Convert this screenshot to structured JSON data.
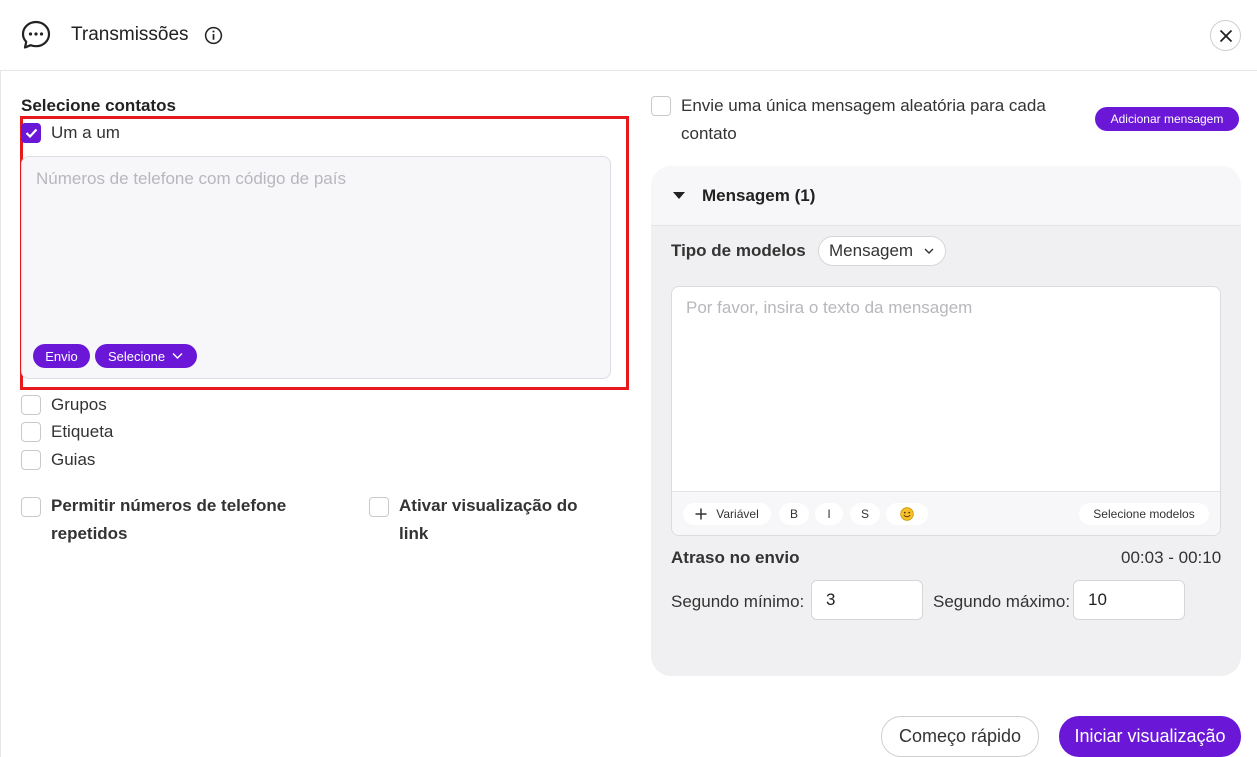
{
  "header": {
    "title": "Transmissões",
    "icons": {
      "app": "chat-dots-icon",
      "info": "info-icon",
      "close": "close-icon"
    }
  },
  "contacts": {
    "section_label": "Selecione contatos",
    "one_by_one": {
      "label": "Um a um",
      "checked": true
    },
    "phone_placeholder": "Números de telefone com código de país",
    "send_btn": "Envio",
    "select_btn": "Selecione",
    "groups": {
      "label": "Grupos",
      "checked": false
    },
    "tag": {
      "label": "Etiqueta",
      "checked": false
    },
    "guides": {
      "label": "Guias",
      "checked": false
    }
  },
  "options": {
    "allow_repeat": {
      "label": "Permitir números de telefone repetidos",
      "checked": false
    },
    "link_preview": {
      "label": "Ativar visualização do link",
      "checked": false
    }
  },
  "random_message": {
    "label": "Envie uma única mensagem aleatória para cada contato",
    "checked": false,
    "add_btn": "Adicionar mensagem"
  },
  "message_panel": {
    "title": "Mensagem (1)",
    "template_type_label": "Tipo de modelos",
    "template_type_value": "Mensagem",
    "message_placeholder": "Por favor, insira o texto da mensagem",
    "toolbar": {
      "variable": "Variável",
      "bold": "B",
      "italic": "I",
      "strike": "S",
      "emoji_icon": "emoji-icon",
      "select_templates": "Selecione modelos"
    },
    "delay": {
      "label": "Atraso no envio",
      "range": "00:03 - 00:10",
      "min_label": "Segundo mínimo",
      "min_value": "3",
      "max_label": "Segundo máximo",
      "max_value": "10"
    }
  },
  "footer": {
    "quick_start": "Começo rápido",
    "start_preview": "Iniciar visualização"
  },
  "colors": {
    "accent": "#6a17d8",
    "highlight": "#e8191c",
    "panel_bg": "#f0f0f2"
  }
}
